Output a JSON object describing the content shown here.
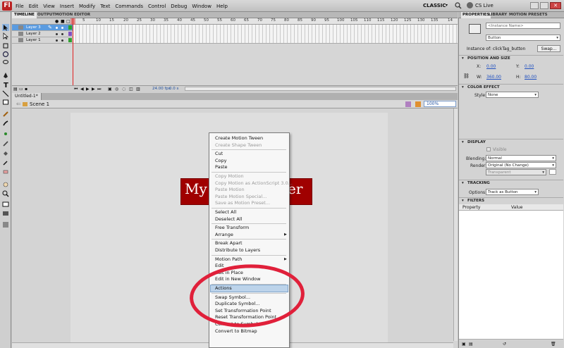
{
  "menubar": {
    "logo": "Fl",
    "items": [
      "File",
      "Edit",
      "View",
      "Insert",
      "Modify",
      "Text",
      "Commands",
      "Control",
      "Debug",
      "Window",
      "Help"
    ],
    "workspace": "CLASSIC",
    "cs_live": "CS Live"
  },
  "timeline": {
    "tabs": [
      "TIMELINE",
      "OUTPUT",
      "MOTION EDITOR"
    ],
    "layers": [
      "Layer 3",
      "Layer 2",
      "Layer 1"
    ],
    "frame_ticks": [
      "5",
      "10",
      "15",
      "20",
      "25",
      "30",
      "35",
      "40",
      "45",
      "50",
      "55",
      "60",
      "65",
      "70",
      "75",
      "80",
      "85",
      "90",
      "95",
      "100",
      "105",
      "110",
      "115",
      "120",
      "125",
      "130",
      "135",
      "14"
    ],
    "fps": "24.00 fps",
    "time": "0.0 s"
  },
  "document": {
    "tab": "Untitled-1*",
    "scene": "Scene 1",
    "zoom": "100%",
    "banner_left": "My",
    "banner_right": "er"
  },
  "context_menu": {
    "items": [
      {
        "label": "Create Motion Tween",
        "disabled": false
      },
      {
        "label": "Create Shape Tween",
        "disabled": true
      },
      {
        "sep": true
      },
      {
        "label": "Cut",
        "disabled": false
      },
      {
        "label": "Copy",
        "disabled": false
      },
      {
        "label": "Paste",
        "disabled": false
      },
      {
        "sep": true
      },
      {
        "label": "Copy Motion",
        "disabled": true
      },
      {
        "label": "Copy Motion as ActionScript 3.0...",
        "disabled": true
      },
      {
        "label": "Paste Motion",
        "disabled": true
      },
      {
        "label": "Paste Motion Special...",
        "disabled": true
      },
      {
        "label": "Save as Motion Preset...",
        "disabled": true
      },
      {
        "sep": true
      },
      {
        "label": "Select All",
        "disabled": false
      },
      {
        "label": "Deselect All",
        "disabled": false
      },
      {
        "sep": true
      },
      {
        "label": "Free Transform",
        "disabled": false
      },
      {
        "label": "Arrange",
        "disabled": false,
        "submenu": true
      },
      {
        "sep": true
      },
      {
        "label": "Break Apart",
        "disabled": false
      },
      {
        "label": "Distribute to Layers",
        "disabled": false
      },
      {
        "sep": true
      },
      {
        "label": "Motion Path",
        "disabled": false,
        "submenu": true
      },
      {
        "label": "Edit",
        "disabled": false
      },
      {
        "label": "Edit in Place",
        "disabled": false
      },
      {
        "label": "Edit in New Window",
        "disabled": false
      },
      {
        "sep": true
      },
      {
        "label": "Actions",
        "disabled": false,
        "highlighted": true
      },
      {
        "sep": true
      },
      {
        "label": "Swap Symbol...",
        "disabled": false
      },
      {
        "label": "Duplicate Symbol...",
        "disabled": false
      },
      {
        "label": "Set Transformation Point",
        "disabled": false
      },
      {
        "label": "Reset Transformation Point",
        "disabled": false
      },
      {
        "label": "Convert to Symbol...",
        "disabled": false
      },
      {
        "label": "Convert to Bitmap",
        "disabled": false
      }
    ]
  },
  "properties": {
    "tabs": [
      "PROPERTIES",
      "LIBRARY",
      "MOTION PRESETS"
    ],
    "instance_name_placeholder": "<Instance Name>",
    "symbol_type": "Button",
    "instance_of": "Instance of:  clickTag_button",
    "swap": "Swap...",
    "sections": {
      "position": "POSITION AND SIZE",
      "color": "COLOR EFFECT",
      "display": "DISPLAY",
      "tracking": "TRACKING",
      "filters": "FILTERS"
    },
    "x_label": "X:",
    "x_value": "0.00",
    "y_label": "Y:",
    "y_value": "0.00",
    "w_label": "W:",
    "w_value": "360.00",
    "h_label": "H:",
    "h_value": "80.00",
    "style_label": "Style:",
    "style_value": "None",
    "visible": "Visible",
    "blending_label": "Blending:",
    "blending_value": "Normal",
    "render_label": "Render:",
    "render_value": "Original (No Change)",
    "transparent_value": "Transparent",
    "options_label": "Options:",
    "options_value": "Track as Button",
    "filters_property": "Property",
    "filters_value": "Value"
  },
  "colors": {
    "annotation": "#e0203a",
    "banner": "#a00000",
    "highlight": "#bcd3ea"
  }
}
